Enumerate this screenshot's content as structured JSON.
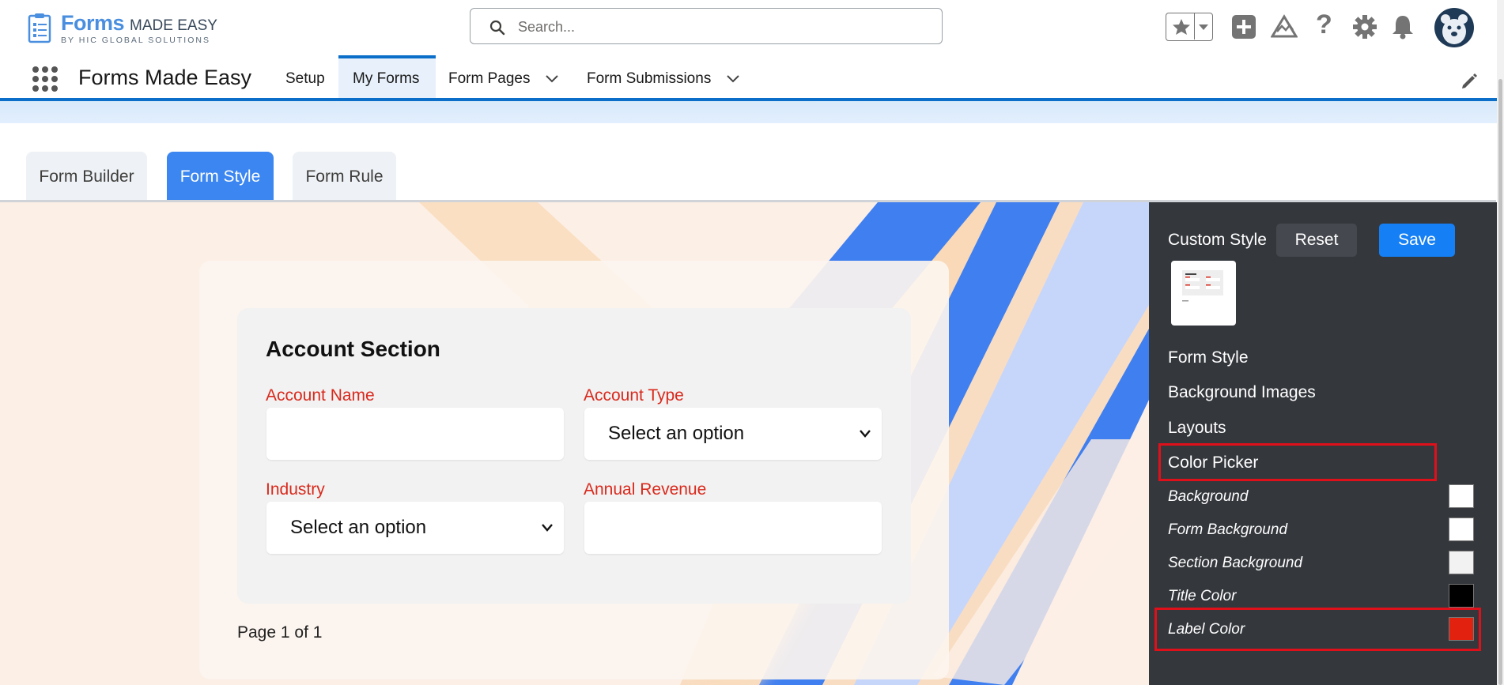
{
  "brand": {
    "logo_main": "Forms",
    "logo_sub": "MADE EASY",
    "logo_tag": "BY HIC GLOBAL SOLUTIONS"
  },
  "search": {
    "placeholder": "Search..."
  },
  "nav": {
    "app_name": "Forms Made Easy",
    "items": [
      {
        "label": "Setup"
      },
      {
        "label": "My Forms"
      },
      {
        "label": "Form Pages"
      },
      {
        "label": "Form Submissions"
      }
    ]
  },
  "tabs": [
    {
      "label": "Form Builder"
    },
    {
      "label": "Form Style"
    },
    {
      "label": "Form Rule"
    }
  ],
  "form": {
    "section_title": "Account Section",
    "fields": [
      {
        "label": "Account Name",
        "value": ""
      },
      {
        "label": "Account Type",
        "value": "Select an option"
      },
      {
        "label": "Industry",
        "value": "Select an option"
      },
      {
        "label": "Annual Revenue",
        "value": ""
      }
    ],
    "page_indicator": "Page 1 of 1"
  },
  "panel": {
    "title": "Custom Style",
    "reset_label": "Reset",
    "save_label": "Save",
    "menu": [
      {
        "label": "Form Style"
      },
      {
        "label": "Background Images"
      },
      {
        "label": "Layouts"
      },
      {
        "label": "Color Picker"
      }
    ],
    "colors": [
      {
        "label": "Background",
        "value": "#FFFFFF"
      },
      {
        "label": "Form Background",
        "value": "#FFFFFF"
      },
      {
        "label": "Section Background",
        "value": "#F2F2F2"
      },
      {
        "label": "Title Color",
        "value": "#000000"
      },
      {
        "label": "Label Color",
        "value": "#E3210F"
      }
    ]
  },
  "theme": {
    "accent": "#0B6FC9",
    "tab_active": "#3B86F0",
    "save_button": "#1580F5",
    "panel_bg": "#34373C",
    "highlight": "#E0101A"
  },
  "icons": {
    "header": [
      "star-icon",
      "chevron-down-icon",
      "plus-icon",
      "trailhead-icon",
      "help-icon",
      "gear-icon",
      "bell-icon",
      "avatar"
    ],
    "nav": [
      "app-launcher-icon",
      "pencil-icon"
    ]
  }
}
